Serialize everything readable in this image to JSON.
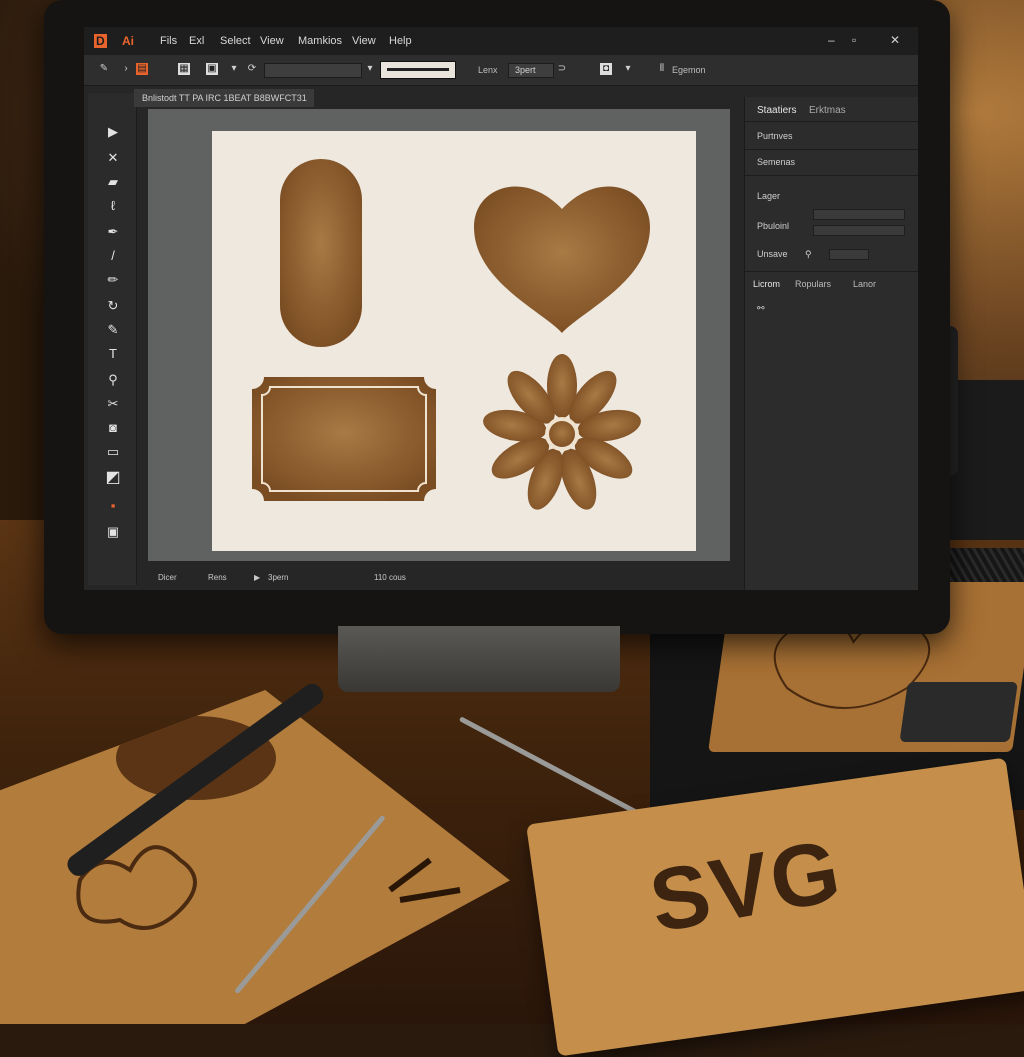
{
  "app": {
    "logos": [
      "D",
      "Ai"
    ],
    "menus": [
      "Fils",
      "Exl",
      "Select",
      "View",
      "Mamkios",
      "View",
      "Help"
    ],
    "window_controls": [
      "–",
      "▫",
      "✕"
    ]
  },
  "control_bar": {
    "label_lens": "Lenx",
    "value_field": "3pert",
    "label_right": "Egemon"
  },
  "document_tab": "Bnlistodt TT PA IRC 1BEAT B8BWFCT31",
  "panel": {
    "tabs": [
      "Staatiers",
      "Erktmas"
    ],
    "rows": [
      "Purtnves",
      "Semenas",
      "Lager",
      "Pbuloinl",
      "Unsave"
    ],
    "lower_tabs": [
      "Licrom",
      "Ropulars",
      "Lanor"
    ]
  },
  "status_bar": {
    "left": "Dicer",
    "mid": "Rens",
    "zoom": "3pern",
    "right": "110 cous"
  },
  "colors": {
    "accent": "#e8642c",
    "shape_fill": "#8a5a2c",
    "artboard": "#eee8de"
  },
  "props": {
    "card_text": "SVG"
  }
}
